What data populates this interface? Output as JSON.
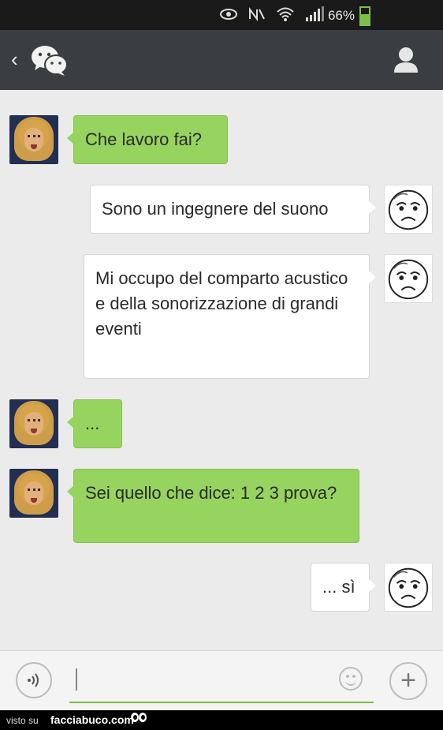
{
  "status_bar": {
    "battery_percent": "66%",
    "icons": [
      "eye-icon",
      "nfc-icon",
      "wifi-icon",
      "signal-icon",
      "battery-icon"
    ]
  },
  "top_bar": {
    "back_glyph": "‹",
    "logo": "wechat-logo-icon",
    "profile": "contact-profile-icon"
  },
  "messages": [
    {
      "side": "left",
      "text": "Che lavoro fai?"
    },
    {
      "side": "right",
      "text": "Sono un ingegnere del suono"
    },
    {
      "side": "right",
      "text": "Mi occupo del comparto acustico e della sonorizzazione di grandi eventi"
    },
    {
      "side": "left",
      "text": "..."
    },
    {
      "side": "left",
      "text": "Sei quello che dice: 1 2 3 prova?"
    },
    {
      "side": "right",
      "text": "... sì"
    }
  ],
  "input_bar": {
    "value": "",
    "voice_icon": "voice-icon",
    "emoji_icon": "smiley-icon",
    "plus_label": "+"
  },
  "footer": {
    "visto_su": "visto su",
    "site": "facciabuco.com"
  },
  "colors": {
    "green_bubble": "#96d35f",
    "top_bar": "#3a3e42",
    "chat_background": "#ebebeb"
  }
}
